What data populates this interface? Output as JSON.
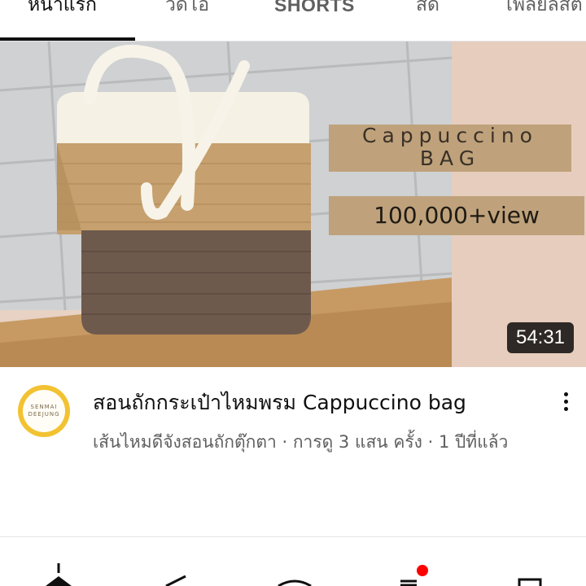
{
  "tabs": [
    {
      "label": "หน้าแรก",
      "active": true
    },
    {
      "label": "วิดีโอ",
      "active": false
    },
    {
      "label": "SHORTS",
      "active": false
    },
    {
      "label": "สด",
      "active": false
    },
    {
      "label": "เพลย์ลิสต์",
      "active": false
    }
  ],
  "video": {
    "overlay_title": "Cappuccino BAG",
    "overlay_views": "100,000+view",
    "duration": "54:31",
    "title": "สอนถักกระเป๋าไหมพรม Cappuccino bag",
    "meta": "เส้นไหมดีจังสอนถักตุ๊กตา · การดู 3 แสน ครั้ง · 1 ปีที่แล้ว",
    "channel_avatar_text": "SENMAI DEEJUNG"
  },
  "icons": {
    "more": "more-vert-icon",
    "nav": [
      "home-icon",
      "shorts-icon",
      "create-icon",
      "subscriptions-icon",
      "library-icon"
    ]
  },
  "colors": {
    "accent_red": "#ff0000",
    "overlay_tan": "#bfa27b"
  }
}
